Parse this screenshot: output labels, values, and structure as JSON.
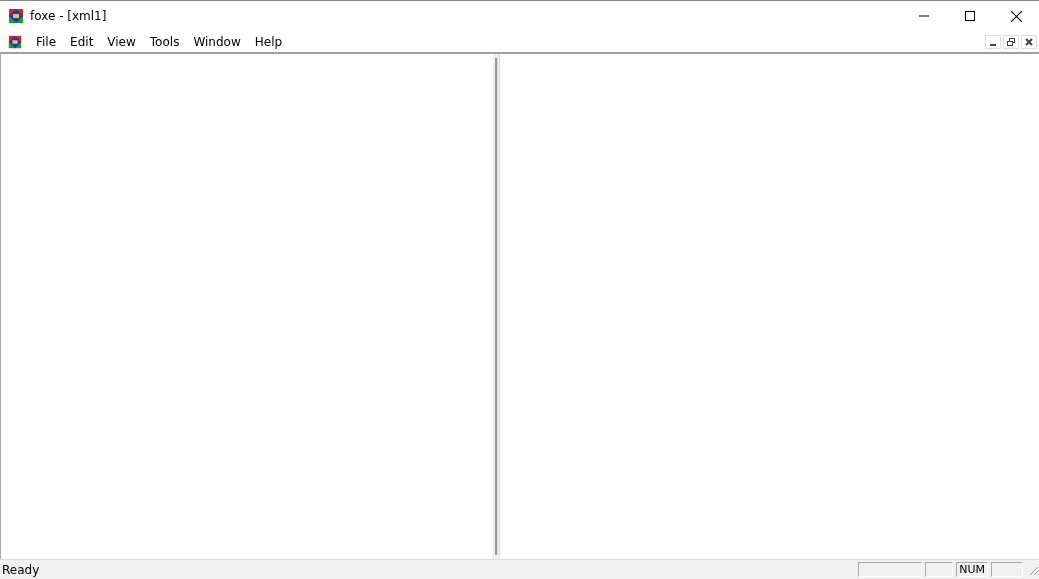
{
  "window": {
    "title": "foxe - [xml1]"
  },
  "menu": [
    "File",
    "Edit",
    "View",
    "Tools",
    "Window",
    "Help"
  ],
  "status_bar": {
    "message": "Ready",
    "indicator": "NUM"
  }
}
